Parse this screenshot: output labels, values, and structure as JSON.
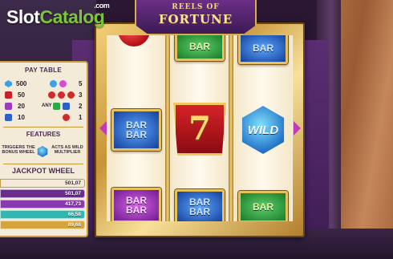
{
  "logo": {
    "slot": "Slot",
    "catalog": "Catalog",
    "com": ".com"
  },
  "title": {
    "line1": "REELS OF",
    "line2": "FORTUNE"
  },
  "reels": {
    "reel1": [
      {
        "symbol": "cherry-icon",
        "label": ""
      },
      {
        "symbol": "bar-blue",
        "label": "BAR\nBAR"
      },
      {
        "symbol": "bar-purple",
        "label": "BAR\nBAR"
      }
    ],
    "reel2": [
      {
        "symbol": "bar-green",
        "label": "BAR"
      },
      {
        "symbol": "seven",
        "label": "7"
      },
      {
        "symbol": "bar-blue",
        "label": "BAR\nBAR"
      }
    ],
    "reel3": [
      {
        "symbol": "bar-blue",
        "label": "BAR"
      },
      {
        "symbol": "wild",
        "label": "WILD"
      },
      {
        "symbol": "bar-green",
        "label": "BAR"
      }
    ]
  },
  "paytable": {
    "title": "PAY TABLE",
    "left": [
      {
        "icon": "wild-gem-icon",
        "value": "500",
        "color": "#3aa0e8"
      },
      {
        "icon": "seven-icon",
        "value": "50",
        "color": "#c8202a"
      },
      {
        "icon": "triple-bar-icon",
        "value": "20",
        "color": "#9b3bc0"
      },
      {
        "icon": "double-bar-icon",
        "value": "10",
        "color": "#2a62c8"
      }
    ],
    "right": [
      {
        "icon": "any-combo-icon",
        "value": "5",
        "prefix": ""
      },
      {
        "icon": "cherry-combo-icon",
        "value": "3",
        "prefix": ""
      },
      {
        "icon": "bar-combo-icon",
        "value": "2",
        "prefix": "ANY"
      },
      {
        "icon": "cherry-icon",
        "value": "1",
        "prefix": ""
      }
    ]
  },
  "features": {
    "title": "FEATURES",
    "left_text": "TRIGGERS THE\nBONUS WHEEL",
    "right_text": "ACTS AS WILD\nMULTIPLIER"
  },
  "jackpot": {
    "title": "JACKPOT WHEEL",
    "rows": [
      {
        "value": "501,07",
        "color": "#f3ead7",
        "text_color": "#3a2a42"
      },
      {
        "value": "501,07",
        "color": "#6a2d8e",
        "text_color": "#ffffff"
      },
      {
        "value": "417,73",
        "color": "#8a3ab0",
        "text_color": "#ffffff"
      },
      {
        "value": "66,58",
        "color": "#2fb7b0",
        "text_color": "#ffffff"
      },
      {
        "value": "89,68",
        "color": "#d6a43c",
        "text_color": "#ffffff"
      }
    ]
  }
}
